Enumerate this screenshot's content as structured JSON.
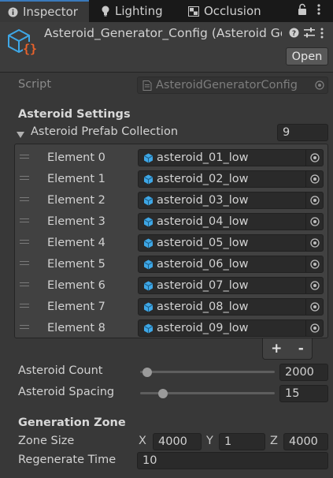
{
  "tabs": [
    {
      "label": "Inspector",
      "icon": "info-icon",
      "active": true
    },
    {
      "label": "Lighting",
      "icon": "lightbulb-icon",
      "active": false
    },
    {
      "label": "Occlusion",
      "icon": "occlusion-icon",
      "active": false
    }
  ],
  "header": {
    "title": "Asteroid_Generator_Config (Asteroid Generator Config)",
    "open_label": "Open"
  },
  "script": {
    "label": "Script",
    "value": "AsteroidGeneratorConfig"
  },
  "asteroid_settings": {
    "heading": "Asteroid Settings",
    "collection_label": "Asteroid Prefab Collection",
    "collection_size": "9",
    "elements": [
      {
        "label": "Element 0",
        "value": "asteroid_01_low"
      },
      {
        "label": "Element 1",
        "value": "asteroid_02_low"
      },
      {
        "label": "Element 2",
        "value": "asteroid_03_low"
      },
      {
        "label": "Element 3",
        "value": "asteroid_04_low"
      },
      {
        "label": "Element 4",
        "value": "asteroid_05_low"
      },
      {
        "label": "Element 5",
        "value": "asteroid_06_low"
      },
      {
        "label": "Element 6",
        "value": "asteroid_07_low"
      },
      {
        "label": "Element 7",
        "value": "asteroid_08_low"
      },
      {
        "label": "Element 8",
        "value": "asteroid_09_low"
      }
    ],
    "add_label": "+",
    "remove_label": "-",
    "count": {
      "label": "Asteroid Count",
      "value": "2000",
      "slider_fraction": 0.05
    },
    "spacing": {
      "label": "Asteroid Spacing",
      "value": "15",
      "slider_fraction": 0.17
    }
  },
  "generation_zone": {
    "heading": "Generation Zone",
    "zone_size": {
      "label": "Zone Size",
      "x_label": "X",
      "x": "4000",
      "y_label": "Y",
      "y": "1",
      "z_label": "Z",
      "z": "4000"
    },
    "regenerate_time": {
      "label": "Regenerate Time",
      "value": "10"
    }
  },
  "colors": {
    "accent": "#3a79bb",
    "asset_icon": "#3ea7e6",
    "script_icon_brace": "#e8622b"
  }
}
